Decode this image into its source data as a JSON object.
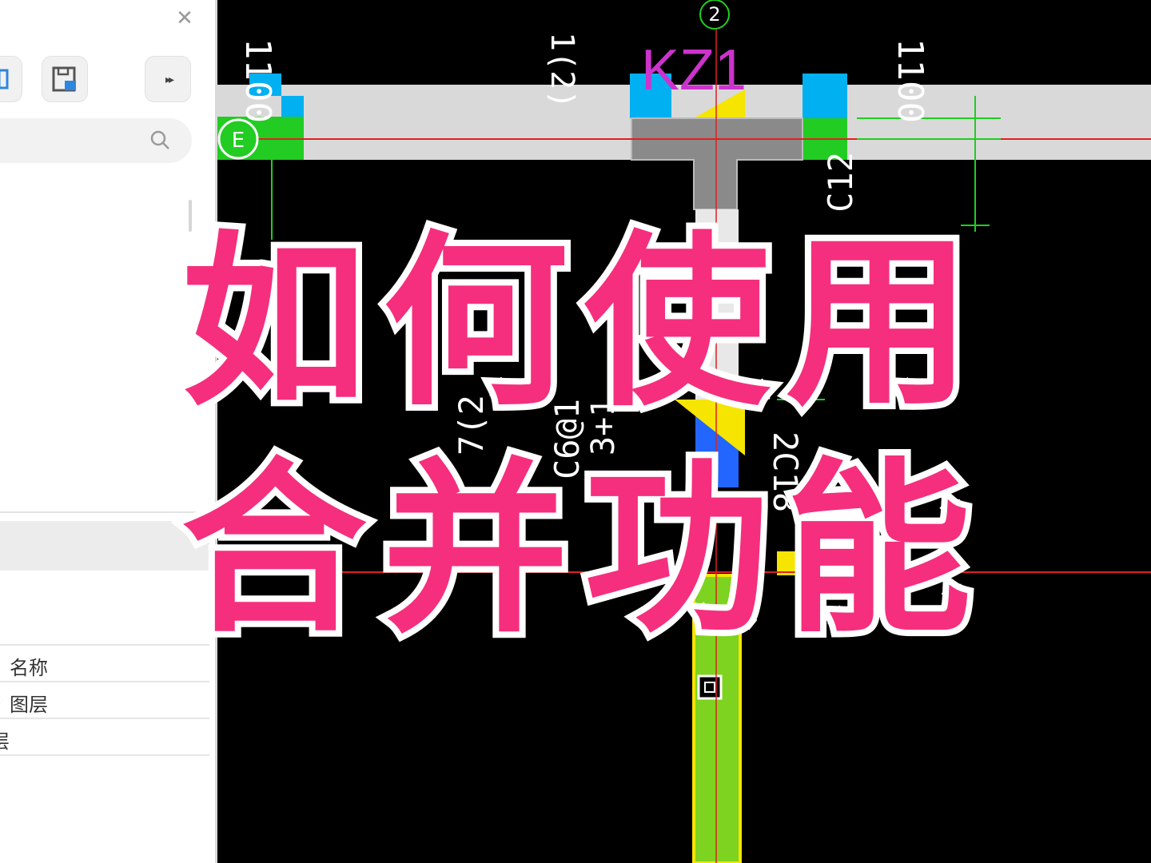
{
  "left_panel": {
    "close_label": "✕",
    "expand_label": "▸▸",
    "properties": {
      "row1": {
        "col_label": "名称"
      },
      "row2": {
        "marker": "◐",
        "col_label": "图层"
      },
      "row3": {
        "col_label": "层"
      }
    }
  },
  "canvas": {
    "axis_top": "2",
    "axis_left": "E",
    "column_label": "KZ1",
    "dim_left": "1100",
    "dim_right": "1100",
    "rebar_1": "C12",
    "rebar_2": "2C18",
    "rebar_3": "C6@1",
    "rebar_4": "3+1",
    "rebar_5": "7(2",
    "rebar_6": "1(2)"
  },
  "overlay": {
    "line1": "如何使用",
    "line2": "合并功能"
  },
  "colors": {
    "accent_pink": "#f52f7d",
    "cad_background": "#000000",
    "beam_gray": "#d9d9d9",
    "blue_column": "#00b0f0",
    "green_line": "#22cc22",
    "magenta_text": "#cc33cc"
  }
}
